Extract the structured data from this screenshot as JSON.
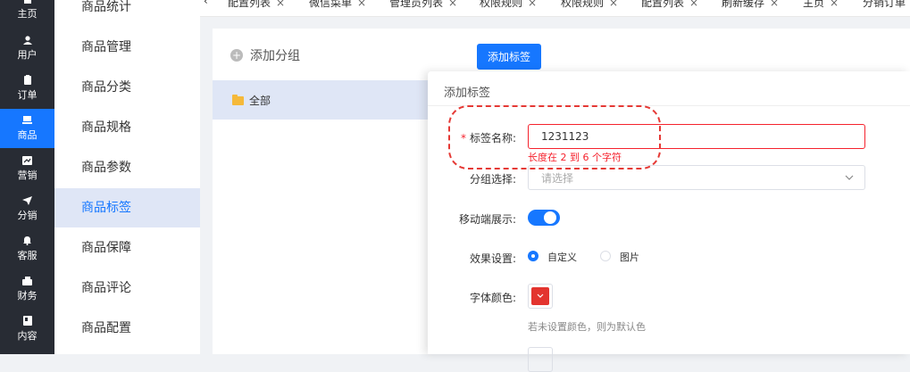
{
  "rail": {
    "items": [
      {
        "label": "主页",
        "icon": "home-icon"
      },
      {
        "label": "用户",
        "icon": "user-icon"
      },
      {
        "label": "订单",
        "icon": "clipboard-icon"
      },
      {
        "label": "商品",
        "icon": "product-icon"
      },
      {
        "label": "营销",
        "icon": "marketing-icon"
      },
      {
        "label": "分销",
        "icon": "send-icon"
      },
      {
        "label": "客服",
        "icon": "bell-icon"
      },
      {
        "label": "财务",
        "icon": "finance-icon"
      },
      {
        "label": "内容",
        "icon": "content-icon"
      }
    ],
    "active_index": 3,
    "active_color": "#1677ff"
  },
  "menu": {
    "items": [
      "商品统计",
      "商品管理",
      "商品分类",
      "商品规格",
      "商品参数",
      "商品标签",
      "商品保障",
      "商品评论",
      "商品配置"
    ],
    "active_index": 5
  },
  "tabs": {
    "back": "‹",
    "items": [
      "配置列表",
      "微信菜单",
      "管理员列表",
      "权限规则",
      "权限规则",
      "配置列表",
      "刷新缓存",
      "主页",
      "分销订单"
    ],
    "close": "×"
  },
  "groups": {
    "add_label": "添加分组",
    "all_label": "全部"
  },
  "toolbar": {
    "add_tag": "添加标签"
  },
  "drawer": {
    "title": "添加标签",
    "name_label": "标签名称:",
    "name_required": "*",
    "name_value": "1231123",
    "name_error": "长度在 2 到 6 个字符",
    "group_label": "分组选择:",
    "group_placeholder": "请选择",
    "mobile_label": "移动端展示:",
    "mobile_on": true,
    "effect_label": "效果设置:",
    "effect_options": [
      "自定义",
      "图片"
    ],
    "effect_selected": 0,
    "font_color_label": "字体颜色:",
    "font_color": "#e3342f",
    "font_color_hint": "若未设置颜色，则为默认色"
  }
}
